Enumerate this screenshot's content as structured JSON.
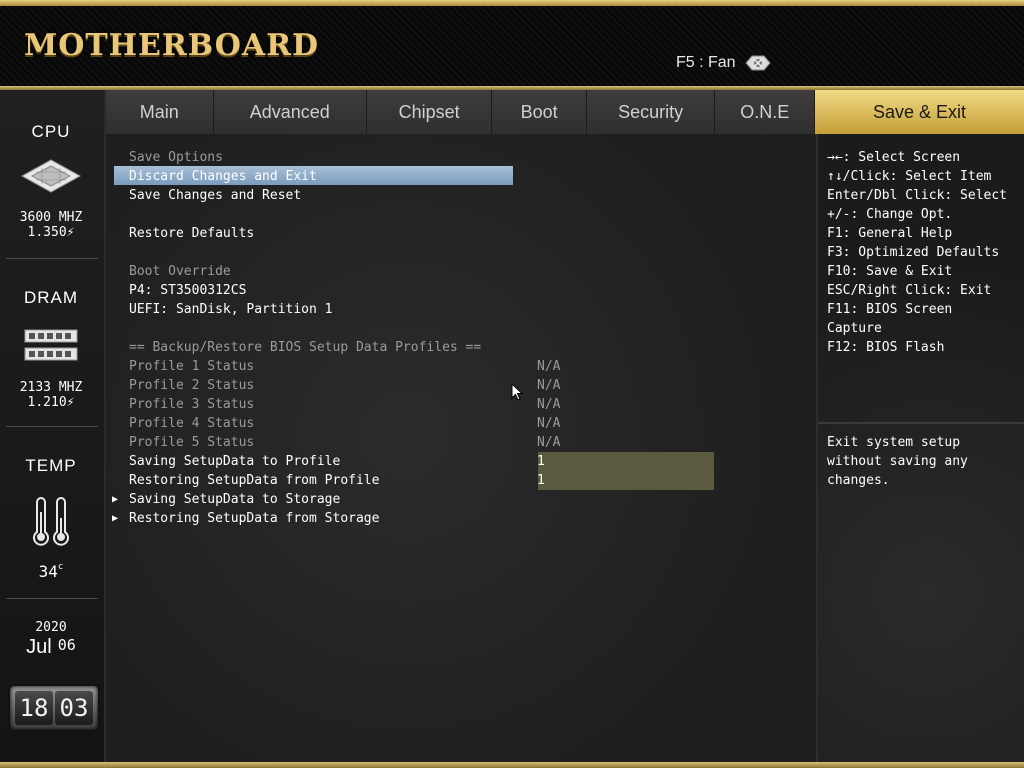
{
  "header": {
    "brand": "MOTHERBOARD",
    "fan_hint": "F5 : Fan"
  },
  "sidebar": {
    "cpu": {
      "title": "CPU",
      "freq": "3600 MHZ",
      "volt": "1.350"
    },
    "dram": {
      "title": "DRAM",
      "freq": "2133 MHZ",
      "volt": "1.210"
    },
    "temp": {
      "title": "TEMP",
      "value": "34"
    },
    "date": {
      "year": "2020",
      "month": "Jul",
      "day": "06"
    },
    "clock": {
      "hours": "18",
      "minutes": "03"
    }
  },
  "tabs": [
    "Main",
    "Advanced",
    "Chipset",
    "Boot",
    "Security",
    "O.N.E"
  ],
  "active_tab": "Save & Exit",
  "menu": {
    "save_options_header": "Save Options",
    "discard_exit": "Discard Changes and Exit",
    "save_reset": "Save Changes and Reset",
    "restore_defaults": "Restore Defaults",
    "boot_override_header": "Boot Override",
    "boot_p4": "P4: ST3500312CS",
    "boot_uefi": "UEFI: SanDisk, Partition 1",
    "backup_header": "== Backup/Restore BIOS Setup Data Profiles ==",
    "profiles": [
      {
        "label": "Profile 1 Status",
        "value": "N/A"
      },
      {
        "label": "Profile 2 Status",
        "value": "N/A"
      },
      {
        "label": "Profile 3 Status",
        "value": "N/A"
      },
      {
        "label": "Profile 4 Status",
        "value": "N/A"
      },
      {
        "label": "Profile 5 Status",
        "value": "N/A"
      }
    ],
    "saving_to_profile": {
      "label": "Saving SetupData to Profile",
      "value": "1"
    },
    "restoring_from_profile": {
      "label": "Restoring SetupData from Profile",
      "value": "1"
    },
    "saving_to_storage": "Saving SetupData to Storage",
    "restoring_from_storage": "Restoring SetupData from Storage"
  },
  "help": {
    "keys": [
      "→←: Select Screen",
      "↑↓/Click: Select Item",
      "Enter/Dbl Click: Select",
      "+/-: Change Opt.",
      "F1: General Help",
      "F3: Optimized Defaults",
      "F10: Save & Exit",
      "ESC/Right Click: Exit",
      "F11: BIOS Screen",
      "Capture",
      "F12: BIOS Flash"
    ],
    "description": [
      "Exit system setup",
      "without saving any",
      "changes."
    ]
  }
}
